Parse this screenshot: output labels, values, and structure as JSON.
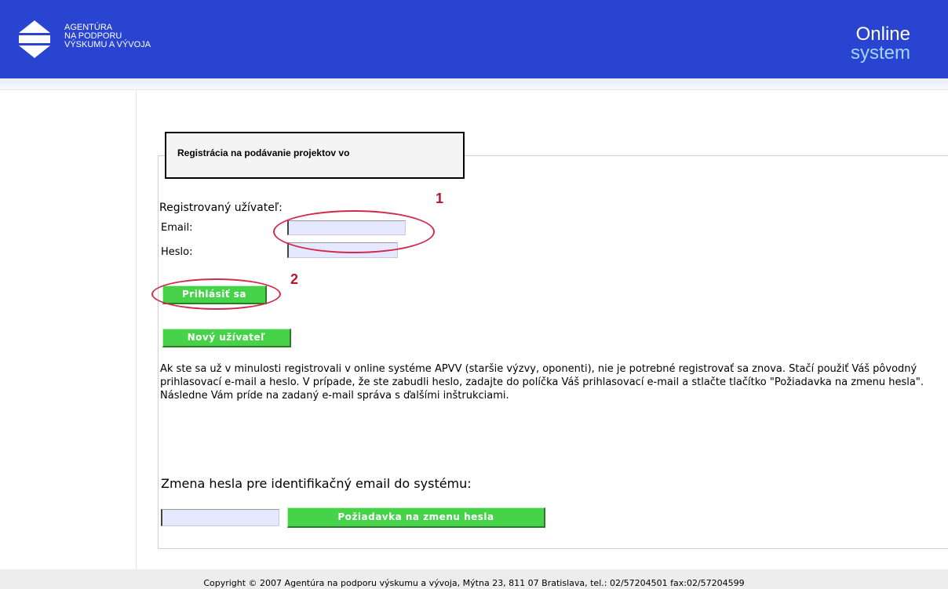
{
  "header": {
    "brand_line1": "AGENTÚRA",
    "brand_line2": "NA PODPORU",
    "brand_line3": "VÝSKUMU A VÝVOJA",
    "online_line1": "Online",
    "online_line2": "system"
  },
  "form": {
    "section_title": "Registrácia na podávanie projektov vo",
    "registered_user_heading": "Registrovaný užívateľ:",
    "email_label": "Email:",
    "email_value": "",
    "password_label": "Heslo:",
    "password_value": "",
    "login_button": "Prihlásiť sa",
    "new_user_button": "Nový užívateľ",
    "marker_1": "1",
    "marker_2": "2",
    "info_text": "Ak ste sa už v minulosti registrovali v online systéme APVV (staršie výzvy, oponenti), nie je potrebné registrovať sa znova. Stačí použiť Váš pôvodný prihlasovací e-mail a heslo. V prípade, že ste zabudli heslo, zadajte do políčka Váš prihlasovací e-mail a stlačte tlačítko \"Požiadavka na zmenu hesla\". Následne Vám príde na zadaný e-mail správa s ďalšími inštrukciami.",
    "change_password_title": "Zmena hesla pre identifikačný email do systému:",
    "change_email_value": "",
    "change_password_button": "Požiadavka na zmenu hesla"
  },
  "footer": {
    "text": "Copyright © 2007 Agentúra na podporu výskumu a vývoja, Mýtna 23, 811 07 Bratislava, tel.: 02/57204501 fax:02/57204599"
  },
  "colors": {
    "header_bg": "#2a44d2",
    "button_green": "#46d34a",
    "annotation_red": "#d02a4a"
  }
}
